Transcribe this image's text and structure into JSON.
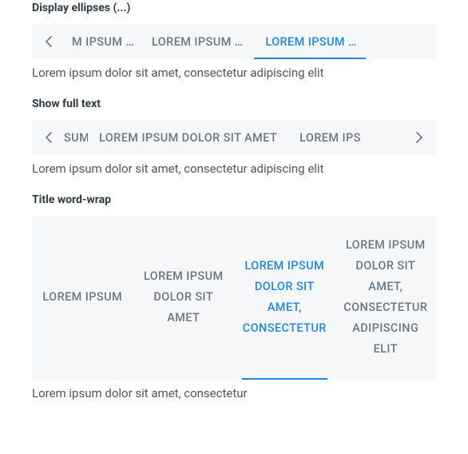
{
  "sections": {
    "ellipses": {
      "title": "Display ellipses (...)",
      "tabs": [
        "M IPSUM …",
        "LOREM IPSUM …",
        "LOREM IPSUM …"
      ],
      "activeIndex": 2,
      "body": "Lorem ipsum dolor sit amet, consectetur adipiscing elit"
    },
    "fulltext": {
      "title": "Show full text",
      "tabs": [
        "SUM",
        "LOREM IPSUM DOLOR SIT AMET",
        "LOREM IPS"
      ],
      "activeIndex": -1,
      "body": "Lorem ipsum dolor sit amet, consectetur adipiscing elit"
    },
    "wordwrap": {
      "title": "Title word-wrap",
      "tabs": [
        "LOREM IPSUM",
        "LOREM IPSUM DOLOR SIT AMET",
        "LOREM IPSUM DOLOR SIT AMET, CONSECTETUR",
        "LOREM IPSUM DOLOR SIT AMET, CONSECTETUR ADIPISCING ELIT"
      ],
      "activeIndex": 2,
      "body": "Lorem ipsum dolor sit amet, consectetur"
    }
  }
}
